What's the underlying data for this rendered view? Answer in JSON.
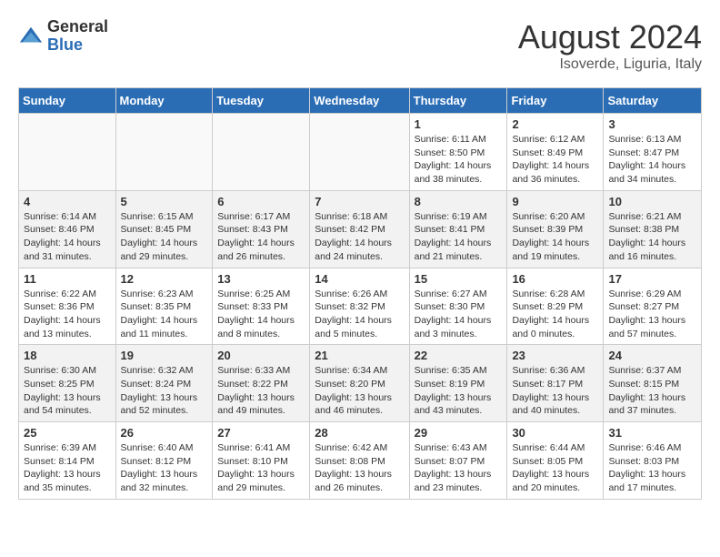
{
  "header": {
    "logo_general": "General",
    "logo_blue": "Blue",
    "month_year": "August 2024",
    "location": "Isoverde, Liguria, Italy"
  },
  "days_of_week": [
    "Sunday",
    "Monday",
    "Tuesday",
    "Wednesday",
    "Thursday",
    "Friday",
    "Saturday"
  ],
  "weeks": [
    [
      {
        "day": "",
        "info": ""
      },
      {
        "day": "",
        "info": ""
      },
      {
        "day": "",
        "info": ""
      },
      {
        "day": "",
        "info": ""
      },
      {
        "day": "1",
        "info": "Sunrise: 6:11 AM\nSunset: 8:50 PM\nDaylight: 14 hours and 38 minutes."
      },
      {
        "day": "2",
        "info": "Sunrise: 6:12 AM\nSunset: 8:49 PM\nDaylight: 14 hours and 36 minutes."
      },
      {
        "day": "3",
        "info": "Sunrise: 6:13 AM\nSunset: 8:47 PM\nDaylight: 14 hours and 34 minutes."
      }
    ],
    [
      {
        "day": "4",
        "info": "Sunrise: 6:14 AM\nSunset: 8:46 PM\nDaylight: 14 hours and 31 minutes."
      },
      {
        "day": "5",
        "info": "Sunrise: 6:15 AM\nSunset: 8:45 PM\nDaylight: 14 hours and 29 minutes."
      },
      {
        "day": "6",
        "info": "Sunrise: 6:17 AM\nSunset: 8:43 PM\nDaylight: 14 hours and 26 minutes."
      },
      {
        "day": "7",
        "info": "Sunrise: 6:18 AM\nSunset: 8:42 PM\nDaylight: 14 hours and 24 minutes."
      },
      {
        "day": "8",
        "info": "Sunrise: 6:19 AM\nSunset: 8:41 PM\nDaylight: 14 hours and 21 minutes."
      },
      {
        "day": "9",
        "info": "Sunrise: 6:20 AM\nSunset: 8:39 PM\nDaylight: 14 hours and 19 minutes."
      },
      {
        "day": "10",
        "info": "Sunrise: 6:21 AM\nSunset: 8:38 PM\nDaylight: 14 hours and 16 minutes."
      }
    ],
    [
      {
        "day": "11",
        "info": "Sunrise: 6:22 AM\nSunset: 8:36 PM\nDaylight: 14 hours and 13 minutes."
      },
      {
        "day": "12",
        "info": "Sunrise: 6:23 AM\nSunset: 8:35 PM\nDaylight: 14 hours and 11 minutes."
      },
      {
        "day": "13",
        "info": "Sunrise: 6:25 AM\nSunset: 8:33 PM\nDaylight: 14 hours and 8 minutes."
      },
      {
        "day": "14",
        "info": "Sunrise: 6:26 AM\nSunset: 8:32 PM\nDaylight: 14 hours and 5 minutes."
      },
      {
        "day": "15",
        "info": "Sunrise: 6:27 AM\nSunset: 8:30 PM\nDaylight: 14 hours and 3 minutes."
      },
      {
        "day": "16",
        "info": "Sunrise: 6:28 AM\nSunset: 8:29 PM\nDaylight: 14 hours and 0 minutes."
      },
      {
        "day": "17",
        "info": "Sunrise: 6:29 AM\nSunset: 8:27 PM\nDaylight: 13 hours and 57 minutes."
      }
    ],
    [
      {
        "day": "18",
        "info": "Sunrise: 6:30 AM\nSunset: 8:25 PM\nDaylight: 13 hours and 54 minutes."
      },
      {
        "day": "19",
        "info": "Sunrise: 6:32 AM\nSunset: 8:24 PM\nDaylight: 13 hours and 52 minutes."
      },
      {
        "day": "20",
        "info": "Sunrise: 6:33 AM\nSunset: 8:22 PM\nDaylight: 13 hours and 49 minutes."
      },
      {
        "day": "21",
        "info": "Sunrise: 6:34 AM\nSunset: 8:20 PM\nDaylight: 13 hours and 46 minutes."
      },
      {
        "day": "22",
        "info": "Sunrise: 6:35 AM\nSunset: 8:19 PM\nDaylight: 13 hours and 43 minutes."
      },
      {
        "day": "23",
        "info": "Sunrise: 6:36 AM\nSunset: 8:17 PM\nDaylight: 13 hours and 40 minutes."
      },
      {
        "day": "24",
        "info": "Sunrise: 6:37 AM\nSunset: 8:15 PM\nDaylight: 13 hours and 37 minutes."
      }
    ],
    [
      {
        "day": "25",
        "info": "Sunrise: 6:39 AM\nSunset: 8:14 PM\nDaylight: 13 hours and 35 minutes."
      },
      {
        "day": "26",
        "info": "Sunrise: 6:40 AM\nSunset: 8:12 PM\nDaylight: 13 hours and 32 minutes."
      },
      {
        "day": "27",
        "info": "Sunrise: 6:41 AM\nSunset: 8:10 PM\nDaylight: 13 hours and 29 minutes."
      },
      {
        "day": "28",
        "info": "Sunrise: 6:42 AM\nSunset: 8:08 PM\nDaylight: 13 hours and 26 minutes."
      },
      {
        "day": "29",
        "info": "Sunrise: 6:43 AM\nSunset: 8:07 PM\nDaylight: 13 hours and 23 minutes."
      },
      {
        "day": "30",
        "info": "Sunrise: 6:44 AM\nSunset: 8:05 PM\nDaylight: 13 hours and 20 minutes."
      },
      {
        "day": "31",
        "info": "Sunrise: 6:46 AM\nSunset: 8:03 PM\nDaylight: 13 hours and 17 minutes."
      }
    ]
  ]
}
